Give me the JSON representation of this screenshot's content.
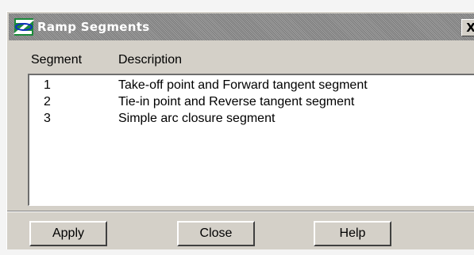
{
  "window": {
    "title": "Ramp Segments",
    "close_glyph": "X",
    "icon": "ramp-app-icon"
  },
  "list": {
    "columns": [
      "Segment",
      "Description"
    ],
    "rows": [
      {
        "segment": "1",
        "description": "Take-off point and Forward tangent segment"
      },
      {
        "segment": "2",
        "description": "Tie-in point and Reverse tangent segment"
      },
      {
        "segment": "3",
        "description": "Simple arc closure segment"
      }
    ]
  },
  "buttons": {
    "apply": "Apply",
    "close": "Close",
    "help": "Help"
  },
  "colors": {
    "dialog_face": "#d4d0c8",
    "list_background": "#ffffff",
    "title_bar_dither": "#8a8a8a"
  }
}
